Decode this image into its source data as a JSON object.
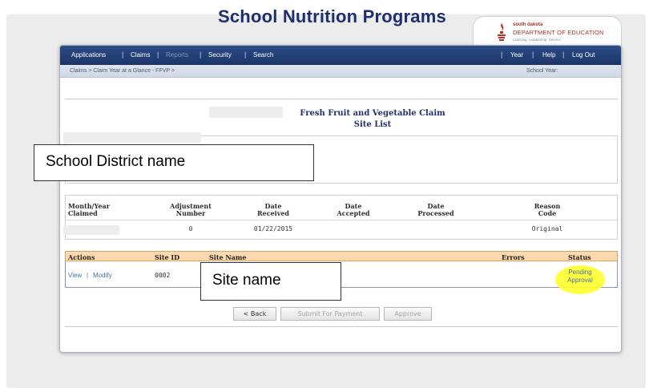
{
  "header": {
    "title": "School Nutrition Programs"
  },
  "logo": {
    "line1": "south dakota",
    "line2": "DEPARTMENT OF EDUCATION",
    "tagline": "Learning. Leadership. Service."
  },
  "nav": {
    "left": [
      {
        "label": "Applications",
        "enabled": true
      },
      {
        "label": "Claims",
        "enabled": true
      },
      {
        "label": "Reports",
        "enabled": false
      },
      {
        "label": "Security",
        "enabled": true
      },
      {
        "label": "Search",
        "enabled": true
      }
    ],
    "right": [
      {
        "label": "Year"
      },
      {
        "label": "Help"
      },
      {
        "label": "Log Out"
      }
    ],
    "separator": "|"
  },
  "breadcrumb": {
    "path": "Claims > Claim Year at a Glance - FFVP >",
    "school_year_label": "School Year:"
  },
  "page": {
    "title_line1": "Fresh Fruit and Vegetable Claim",
    "title_line2": "Site List"
  },
  "claim_table": {
    "headers": {
      "month_year": [
        "Month/Year",
        "Claimed"
      ],
      "adjustment": [
        "Adjustment",
        "Number"
      ],
      "received": [
        "Date",
        "Received"
      ],
      "accepted": [
        "Date",
        "Accepted"
      ],
      "processed": [
        "Date",
        "Processed"
      ],
      "reason": [
        "Reason",
        "Code"
      ]
    },
    "row": {
      "adjustment_number": "0",
      "date_received": "01/22/2015",
      "date_accepted": "",
      "date_processed": "",
      "reason_code": "Original"
    }
  },
  "sites_table": {
    "headers": {
      "actions": "Actions",
      "site_id": "Site ID",
      "site_name": "Site Name",
      "errors": "Errors",
      "status": "Status"
    },
    "row": {
      "view_link": "View",
      "separator": "|",
      "modify_link": "Modify",
      "site_id": "0002",
      "status_line1": "Pending",
      "status_line2": "Approval"
    }
  },
  "buttons": {
    "back": "< Back",
    "submit": "Submit For Payment",
    "approve": "Approve"
  },
  "annotations": {
    "district": "School District name",
    "site": "Site name"
  },
  "colors": {
    "title": "#1f2f6e",
    "navbar": "#1b3568",
    "sites_header": "#fbd8ad",
    "highlight": "#ffff2e",
    "link": "#4a6fa5"
  }
}
